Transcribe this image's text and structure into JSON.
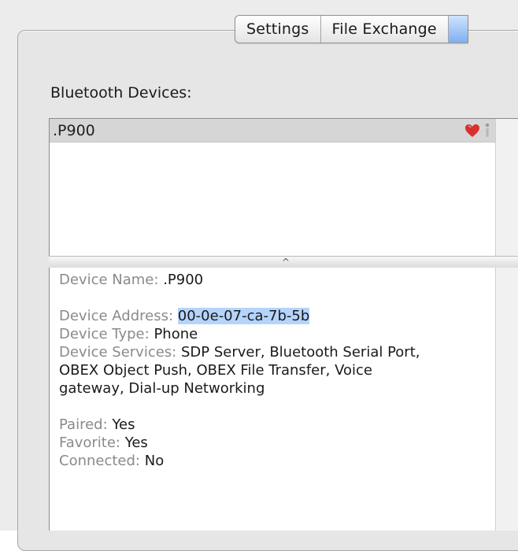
{
  "tabs": [
    {
      "label": "Settings"
    },
    {
      "label": "File Exchange"
    }
  ],
  "devices_label": "Bluetooth Devices:",
  "device_list": {
    "items": [
      {
        "name": ".P900",
        "favorite_icon": "heart-icon",
        "info_icon": "info-icon"
      }
    ]
  },
  "splitter_glyph": "^",
  "details": {
    "device_name": {
      "label": "Device Name:",
      "value": ".P900"
    },
    "device_address": {
      "label": "Device Address:",
      "value": "00-0e-07-ca-7b-5b"
    },
    "device_type": {
      "label": "Device Type:",
      "value": "Phone"
    },
    "device_services": {
      "label": "Device Services:",
      "value_line1": "SDP Server, Bluetooth Serial Port,",
      "value_line2": "OBEX Object Push, OBEX File Transfer, Voice",
      "value_line3": "gateway, Dial-up Networking"
    },
    "paired": {
      "label": "Paired:",
      "value": "Yes"
    },
    "favorite": {
      "label": "Favorite:",
      "value": "Yes"
    },
    "connected": {
      "label": "Connected:",
      "value": "No"
    }
  },
  "colors": {
    "selection_highlight": "#b5d4fb",
    "heart": "#d9302c",
    "selected_tab": "#7fb0f0"
  }
}
